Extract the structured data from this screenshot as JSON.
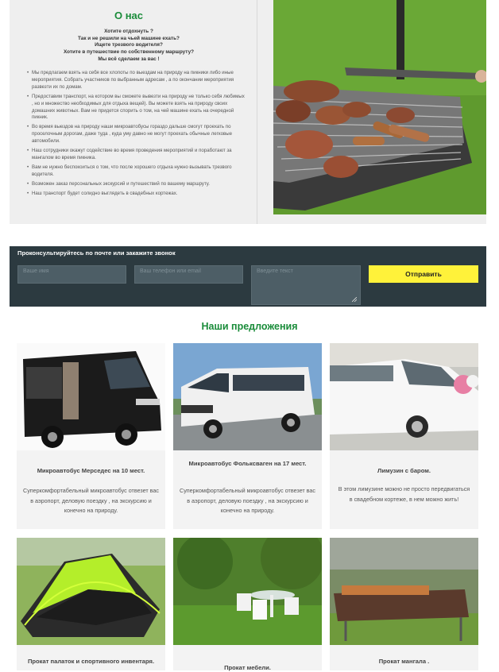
{
  "about": {
    "title": "О нас",
    "questions": [
      "Хотите отдохнуть ?",
      "Так и не решили на чьей машине ехать?",
      "Ищете трезвого водителя?",
      "Хотите в путешествие по собственному маршруту?",
      "Мы всё сделаем за вас !"
    ],
    "list": [
      "Мы предлагаем взять на себя все хлопоты по выездам на природу на пикники либо иные мероприятия. Собрать участников по выбранным адресам , а по окончании мероприятия развезти их по домам.",
      "Предоставим транспорт, на котором вы сможете вывезти на природу не только себя любимых , но и множество необходимых для отдыха вещей). Вы можете взять на природу своих домашних животных. Вам не придется спорить о том, на чей машине ехать на очередной пикник.",
      "Во время выездов на природу наши микроавтобусы гораздо дальше смогут проехать по проселочным дорогам, даже туда , куда уму давно не могут проехать обычные легковые автомобили.",
      "Наш сотрудники окажут содействие во время проведения мероприятий и поработают за мангалом во время пикника.",
      "Вам не нужно беспокоиться о том, что после хорошего отдыха нужно вызывать трезвого водителя.",
      "Возможен заказ персональных экскурсий и путешествий по вашему маршруту.",
      "Наш транспорт будет солидно выглядеть в свадебных кортежах."
    ]
  },
  "consult": {
    "title": "Проконсультируйтесь по почте или закажите звонок",
    "name_placeholder": "Ваше имя",
    "phone_placeholder": "Ваш телефон или email",
    "message_placeholder": "Введите текст",
    "send_label": "Отправить"
  },
  "offers": {
    "title": "Наши предложения",
    "cards": [
      {
        "title": "Микроавтобус Мерседес на 10 мест.",
        "desc": "Суперкомфортабельный микроавтобус отвезет вас в аэропорт, деловую поездку , на экскурсию и конечно на природу."
      },
      {
        "title": "Микроавтобус Фольксваген на 17 мест.",
        "desc": "Суперкомфортабельный микроавтобус отвезет вас в аэропорт, деловую поездку , на экскурсию и конечно на природу."
      },
      {
        "title": "Лимузин с баром.",
        "desc": "В этом лимузине можно не просто передвигаться в свадебном кортеже, в нем можно жить!"
      },
      {
        "title": "Прокат палаток и спортивного инвентаря.",
        "desc": ""
      },
      {
        "title": "Прокат мебели.",
        "desc": ""
      },
      {
        "title": "Прокат мангала .",
        "desc": ""
      }
    ]
  },
  "colors": {
    "accent_green": "#1a8c3a",
    "button_yellow": "#fff23a",
    "form_bg": "#2c3a40"
  },
  "images": [
    "bbq-grill-photo",
    "black-minibus-photo",
    "white-minibus-photo",
    "white-limousine-photo",
    "tent-photo",
    "garden-furniture-photo",
    "brazier-photo"
  ]
}
